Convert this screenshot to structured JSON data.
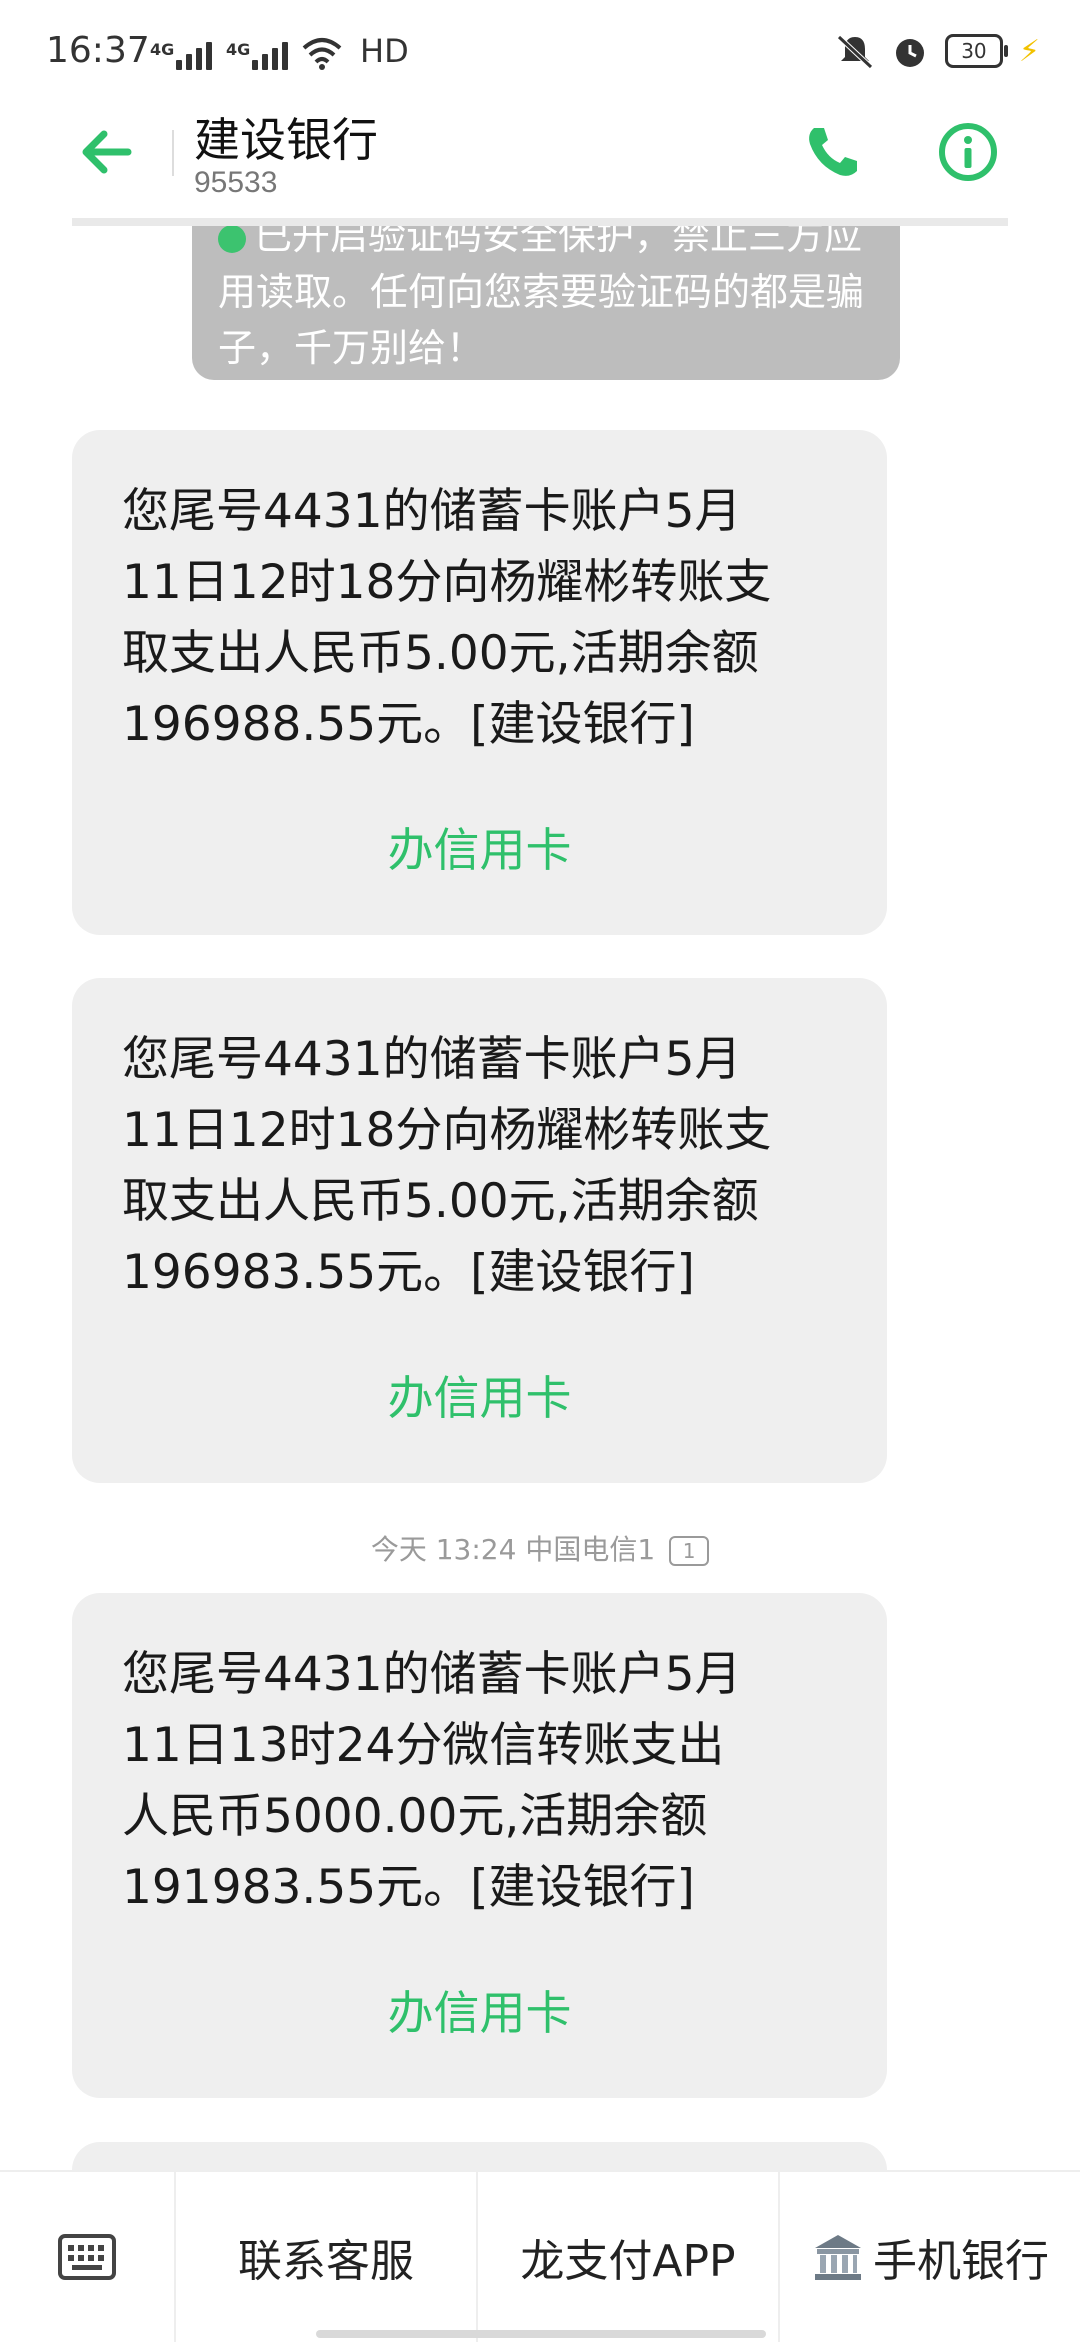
{
  "status_bar": {
    "time": "16:37",
    "signal_tag": "4G",
    "hd": "HD",
    "battery": "30"
  },
  "header": {
    "title": "建设银行",
    "number": "95533"
  },
  "partial_message": {
    "text": "已开启验证码安全保护，禁止三方应用读取。任何向您索要验证码的都是骗子，千万别给！"
  },
  "messages": [
    {
      "text": "您尾号4431的储蓄卡账户5月\n11日12时18分向杨耀彬转账支\n取支出人民币5.00元,活期余额\n196988.55元。[建设银行]",
      "link": "办信用卡"
    },
    {
      "text": "您尾号4431的储蓄卡账户5月\n11日12时18分向杨耀彬转账支\n取支出人民币5.00元,活期余额\n196983.55元。[建设银行]",
      "link": "办信用卡"
    },
    {
      "text": "您尾号4431的储蓄卡账户5月\n11日13时24分微信转账支出\n人民币5000.00元,活期余额\n191983.55元。[建设银行]",
      "link": "办信用卡"
    }
  ],
  "timestamp": {
    "text": "今天 13:24  中国电信1",
    "sim": "1"
  },
  "toolbar": {
    "keyboard": "keyboard-icon",
    "contact": "联系客服",
    "pay_app": "龙支付APP",
    "mobile_bank": "手机银行"
  },
  "colors": {
    "accent": "#2fc06b",
    "bubble": "#efefef",
    "system_bubble": "#bdbdbd"
  }
}
